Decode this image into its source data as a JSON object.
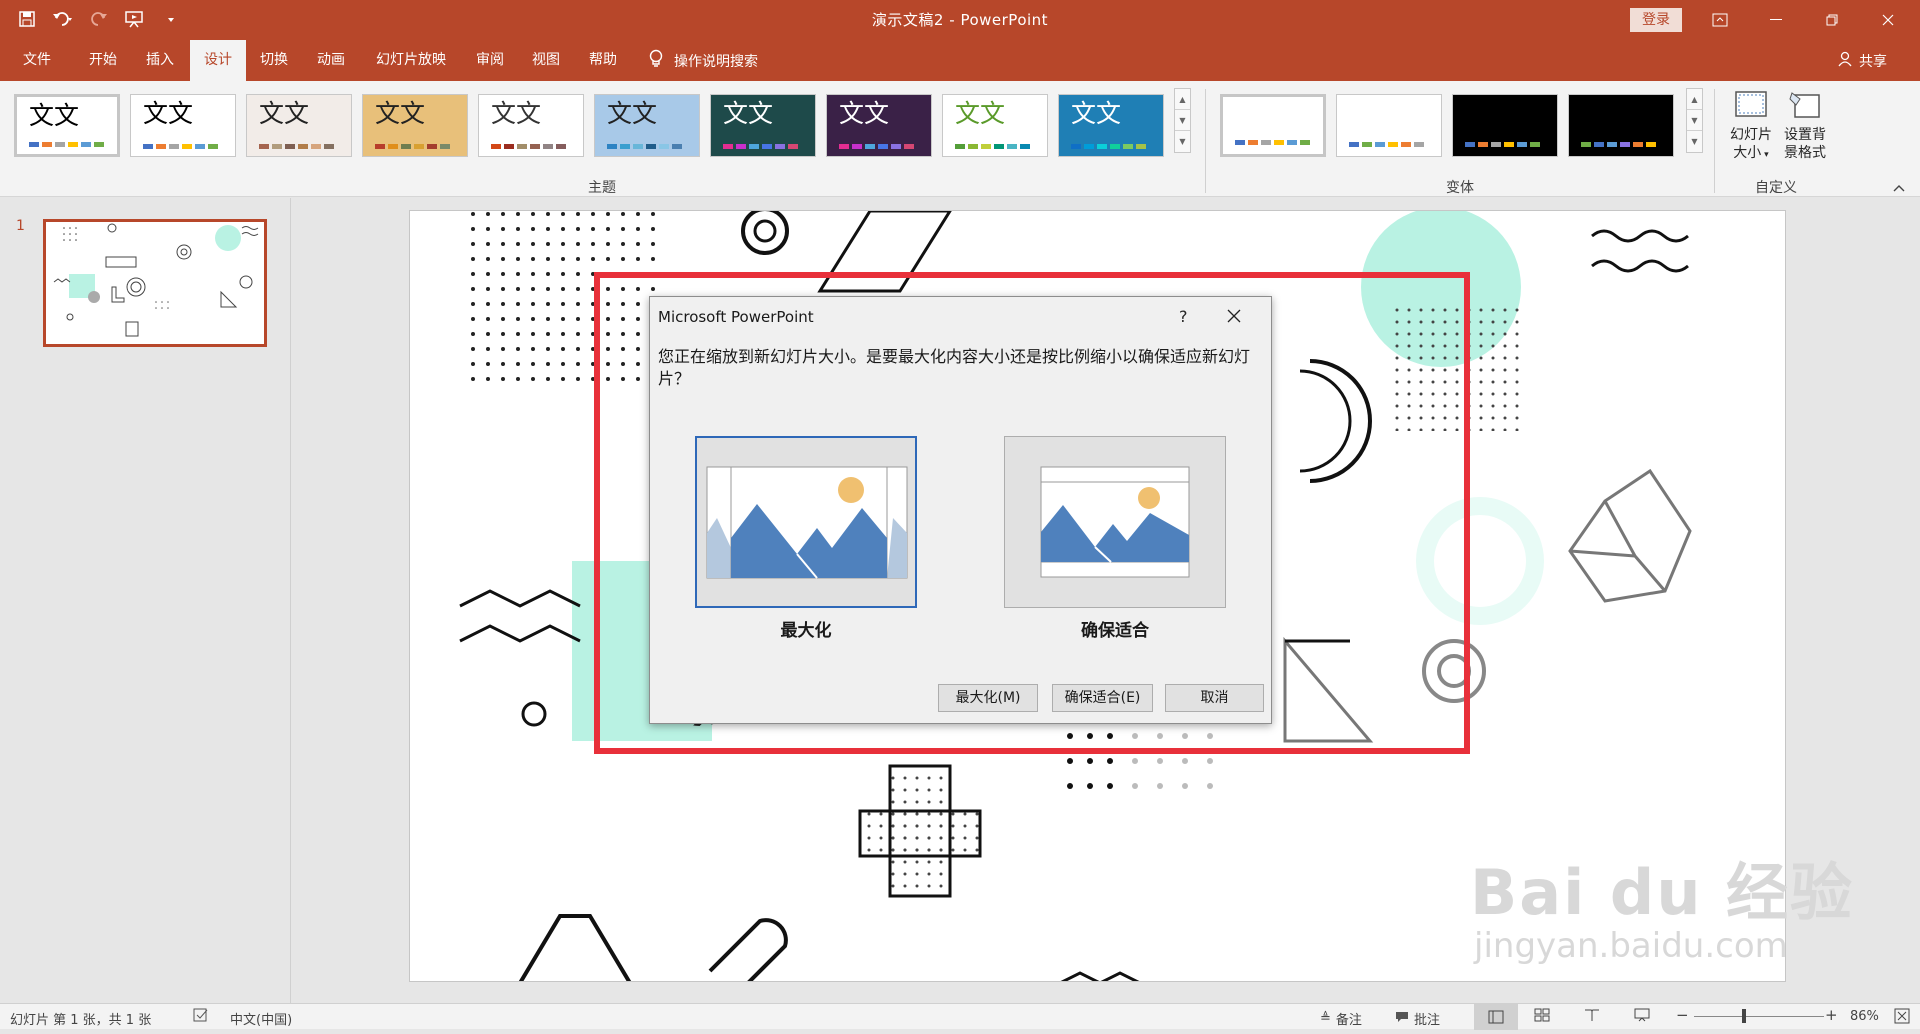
{
  "window": {
    "doc_title": "演示文稿2",
    "app_name": "PowerPoint",
    "title_separator": "-",
    "login_label": "登录"
  },
  "tabs": [
    {
      "label": "文件"
    },
    {
      "label": "开始"
    },
    {
      "label": "插入"
    },
    {
      "label": "设计",
      "active": true
    },
    {
      "label": "切换"
    },
    {
      "label": "动画"
    },
    {
      "label": "幻灯片放映"
    },
    {
      "label": "审阅"
    },
    {
      "label": "视图"
    },
    {
      "label": "帮助"
    }
  ],
  "search_label": "操作说明搜索",
  "share_label": "共享",
  "ribbon": {
    "themes_group_label": "主题",
    "variants_group_label": "变体",
    "customize_group_label": "自定义",
    "theme_sample_text": "文文",
    "themes": [
      {
        "text": "文文",
        "bg": "#ffffff",
        "fg": "#000000",
        "bars": [
          "#4472c4",
          "#ed7d31",
          "#a5a5a5",
          "#ffc000",
          "#5b9bd5",
          "#70ad47"
        ]
      },
      {
        "text": "文文",
        "bg": "#ffffff",
        "fg": "#000000",
        "bars": [
          "#4472c4",
          "#ed7d31",
          "#a5a5a5",
          "#ffc000",
          "#5b9bd5",
          "#70ad47"
        ]
      },
      {
        "text": "文文",
        "bg": "#f2ece8",
        "fg": "#222222",
        "bars": [
          "#a5644e",
          "#b19c7d",
          "#7f5f52",
          "#b27d49",
          "#d6a47c",
          "#857060"
        ]
      },
      {
        "text": "文文",
        "bg": "#e8c07a",
        "fg": "#222222",
        "bars": [
          "#b83d2a",
          "#e08e1a",
          "#6f7d4f",
          "#d8a031",
          "#a43d2e",
          "#7a8a69"
        ]
      },
      {
        "text": "文文",
        "bg": "#ffffff",
        "fg": "#333333",
        "bars": [
          "#d34817",
          "#9b2d1f",
          "#a28e6a",
          "#956251",
          "#918485",
          "#855d5d"
        ]
      },
      {
        "text": "文文",
        "bg": "#a8c9e8",
        "fg": "#222222",
        "bars": [
          "#2d83c3",
          "#3a9fcf",
          "#68b6d9",
          "#1f5c8a",
          "#89c6e6",
          "#4a7fb0"
        ]
      },
      {
        "text": "文文",
        "bg": "#1e4a4a",
        "fg": "#ffffff",
        "bars": [
          "#e32d91",
          "#c830cc",
          "#4ea6dc",
          "#4775e7",
          "#8971e1",
          "#d54773"
        ]
      },
      {
        "text": "文文",
        "bg": "#3a2147",
        "fg": "#ffffff",
        "bars": [
          "#e32d91",
          "#c830cc",
          "#4ea6dc",
          "#4775e7",
          "#8971e1",
          "#d54773"
        ]
      },
      {
        "text": "文文",
        "bg": "#ffffff",
        "fg": "#5a9a2a",
        "bars": [
          "#549e39",
          "#8ab833",
          "#c0cf3a",
          "#029676",
          "#4ab5c4",
          "#0989b1"
        ]
      },
      {
        "text": "文文",
        "bg": "#1f7fb5",
        "fg": "#ffffff",
        "bars": [
          "#0f6fc6",
          "#009dd9",
          "#0bd0d9",
          "#10cf9b",
          "#7cca62",
          "#a5c249"
        ]
      }
    ],
    "variants": [
      {
        "bg": "#ffffff",
        "bars": [
          "#4472c4",
          "#ed7d31",
          "#a5a5a5",
          "#ffc000",
          "#5b9bd5",
          "#70ad47"
        ]
      },
      {
        "bg": "#ffffff",
        "bars": [
          "#4472c4",
          "#70ad47",
          "#5b9bd5",
          "#ffc000",
          "#ed7d31",
          "#a5a5a5"
        ]
      },
      {
        "bg": "#000000",
        "bars": [
          "#4472c4",
          "#ed7d31",
          "#a5a5a5",
          "#ffc000",
          "#5b9bd5",
          "#70ad47"
        ]
      },
      {
        "bg": "#000000",
        "bars": [
          "#70ad47",
          "#4472c4",
          "#5b9bd5",
          "#8971e1",
          "#ed7d31",
          "#ffc000"
        ]
      }
    ],
    "slide_size_label_1": "幻灯片",
    "slide_size_label_2": "大小",
    "format_bg_label_1": "设置背",
    "format_bg_label_2": "景格式"
  },
  "thumbnail": {
    "number": "1"
  },
  "dialog": {
    "title": "Microsoft PowerPoint",
    "help": "?",
    "message": "您正在缩放到新幻灯片大小。是要最大化内容大小还是按比例缩小以确保适应新幻灯片？",
    "option_maximize": "最大化",
    "option_ensure_fit": "确保适合",
    "button_maximize": "最大化(M)",
    "button_ensure_fit": "确保适合(E)",
    "button_cancel": "取消"
  },
  "status": {
    "slide_info": "幻灯片 第 1 张，共 1 张",
    "language": "中文(中国)",
    "notes": "备注",
    "comments": "批注",
    "zoom": "86%",
    "zoom_level": 0.86
  },
  "watermark": {
    "line1": "Bai du 经验",
    "line2": "jingyan.baidu.com"
  },
  "colors": {
    "accent": "#b7472a",
    "highlight_box": "#e8303a",
    "mint": "#b9f2e3",
    "dialog_focus": "#2e68b8",
    "picture_blue": "#4f81bd",
    "sun": "#f0c070"
  }
}
